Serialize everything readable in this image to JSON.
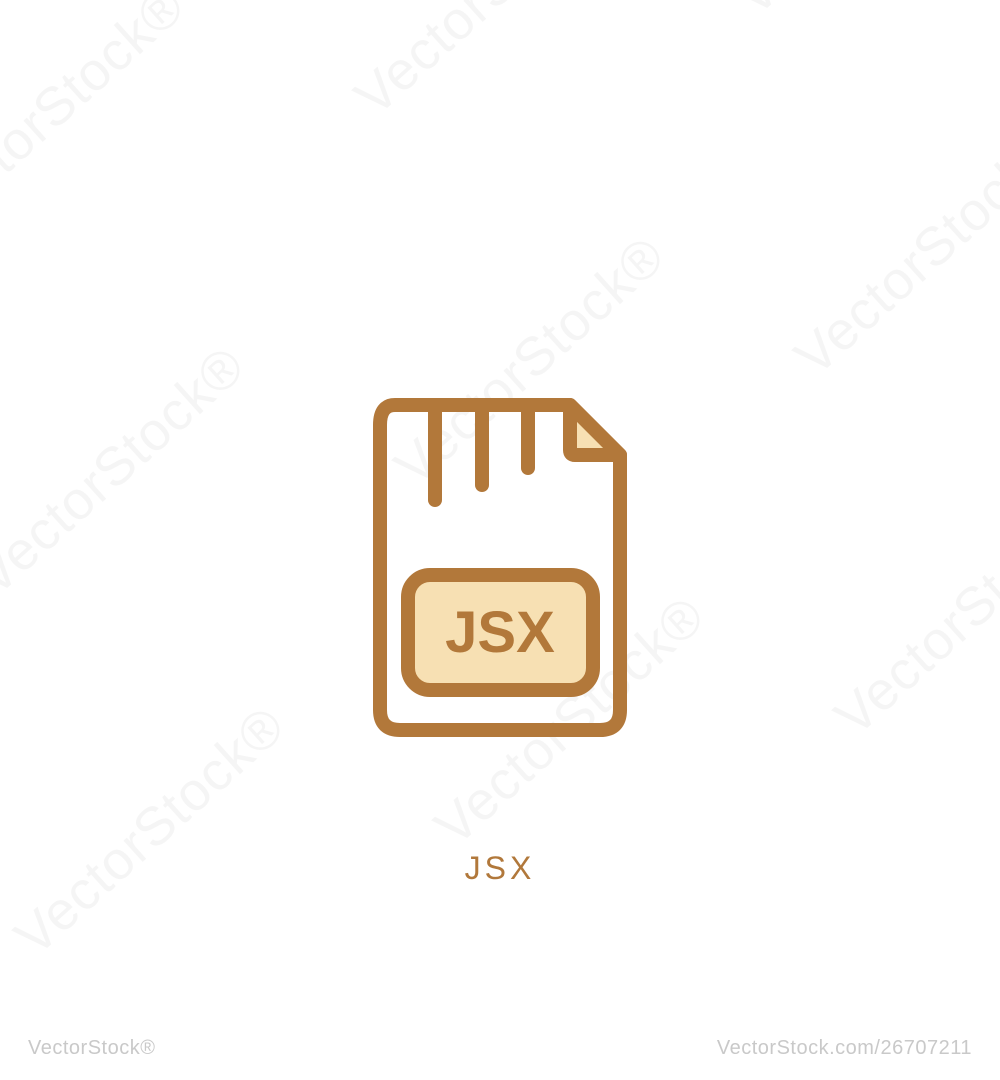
{
  "icon": {
    "file_label": "JSX",
    "stroke_color": "#b2783a",
    "fill_light": "#f7e0b3",
    "fill_dark": "#e9c483"
  },
  "caption": "JSX",
  "watermark": {
    "brand": "VectorStock®",
    "attribution": "VectorStock.com/26707211",
    "diagonal_text": "VectorStock®"
  }
}
